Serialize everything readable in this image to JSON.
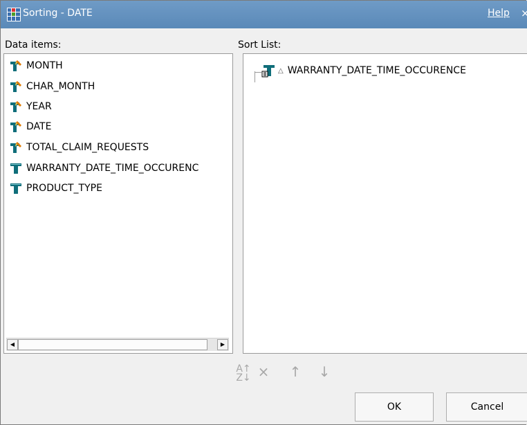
{
  "window": {
    "title": "Sorting - DATE",
    "help": "Help",
    "close": "×"
  },
  "data_items": {
    "label": "Data items:",
    "items": [
      {
        "label": "MONTH",
        "icon": "computed-field-icon"
      },
      {
        "label": "CHAR_MONTH",
        "icon": "computed-field-icon"
      },
      {
        "label": "YEAR",
        "icon": "computed-field-icon"
      },
      {
        "label": "DATE",
        "icon": "computed-field-icon"
      },
      {
        "label": "TOTAL_CLAIM_REQUESTS",
        "icon": "computed-field-icon"
      },
      {
        "label": "WARRANTY_DATE_TIME_OCCURENC",
        "icon": "field-icon"
      },
      {
        "label": "PRODUCT_TYPE",
        "icon": "field-icon"
      }
    ]
  },
  "sort_list": {
    "label": "Sort List:",
    "items": [
      {
        "label": "WARRANTY_DATE_TIME_OCCURENCE",
        "order": "ascending"
      }
    ]
  },
  "toolbar": {
    "sort_order": "A↓Z",
    "remove": "×",
    "move_up": "↑",
    "move_down": "↓"
  },
  "buttons": {
    "ok": "OK",
    "cancel": "Cancel"
  },
  "colors": {
    "titlebar": "#5f8fbf",
    "field_icon_teal": "#0f6e7a",
    "computed_icon_orange": "#e07b00",
    "disabled_tool": "#a8a8a8"
  }
}
